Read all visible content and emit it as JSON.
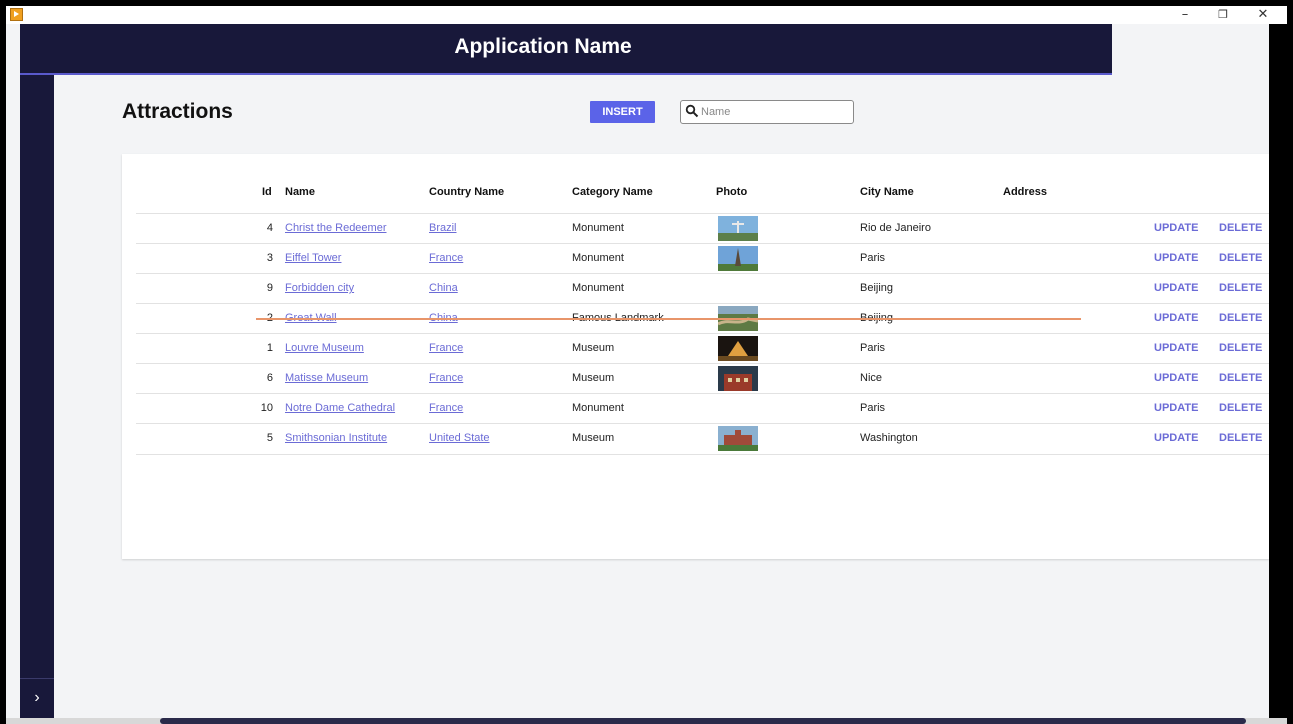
{
  "window": {
    "minimize": "–",
    "maximize": "❐",
    "close": "✕"
  },
  "header": {
    "app_title": "Application Name"
  },
  "sidebar": {
    "expand_glyph": "›"
  },
  "page": {
    "title": "Attractions"
  },
  "toolbar": {
    "insert_label": "INSERT"
  },
  "search": {
    "placeholder": "Name",
    "value": ""
  },
  "table": {
    "columns": {
      "id": "Id",
      "name": "Name",
      "country": "Country Name",
      "category": "Category Name",
      "photo": "Photo",
      "city": "City Name",
      "address": "Address"
    },
    "rows": [
      {
        "id": "4",
        "name": "Christ the Redeemer",
        "country": "Brazil",
        "category": "Monument",
        "photo": "christ-redeemer",
        "city": "Rio de Janeiro",
        "address": "",
        "update": "UPDATE",
        "delete": "DELETE"
      },
      {
        "id": "3",
        "name": "Eiffel Tower",
        "country": "France",
        "category": "Monument",
        "photo": "eiffel-tower",
        "city": "Paris",
        "address": "",
        "update": "UPDATE",
        "delete": "DELETE"
      },
      {
        "id": "9",
        "name": "Forbidden city",
        "country": "China",
        "category": "Monument",
        "photo": "",
        "city": "Beijing",
        "address": "",
        "update": "UPDATE",
        "delete": "DELETE"
      },
      {
        "id": "2",
        "name": "Great Wall",
        "country": "China",
        "category": "Famous Landmark",
        "photo": "great-wall",
        "city": "Beijing",
        "address": "",
        "update": "UPDATE",
        "delete": "DELETE"
      },
      {
        "id": "1",
        "name": "Louvre Museum",
        "country": "France",
        "category": "Museum",
        "photo": "louvre",
        "city": "Paris",
        "address": "",
        "update": "UPDATE",
        "delete": "DELETE"
      },
      {
        "id": "6",
        "name": "Matisse Museum",
        "country": "France",
        "category": "Museum",
        "photo": "matisse-museum",
        "city": "Nice",
        "address": "",
        "update": "UPDATE",
        "delete": "DELETE"
      },
      {
        "id": "10",
        "name": "Notre Dame Cathedral",
        "country": "France",
        "category": "Monument",
        "photo": "",
        "city": "Paris",
        "address": "",
        "update": "UPDATE",
        "delete": "DELETE"
      },
      {
        "id": "5",
        "name": "Smithsonian Institute",
        "country": "United State",
        "category": "Museum",
        "photo": "smithsonian",
        "city": "Washington",
        "address": "",
        "update": "UPDATE",
        "delete": "DELETE"
      }
    ]
  },
  "colors": {
    "header_bg": "#18183a",
    "accent": "#5b63e8",
    "link": "#6b6bd6",
    "page_bg": "#f3f4f6",
    "annotation_strike": "#e8956a"
  }
}
